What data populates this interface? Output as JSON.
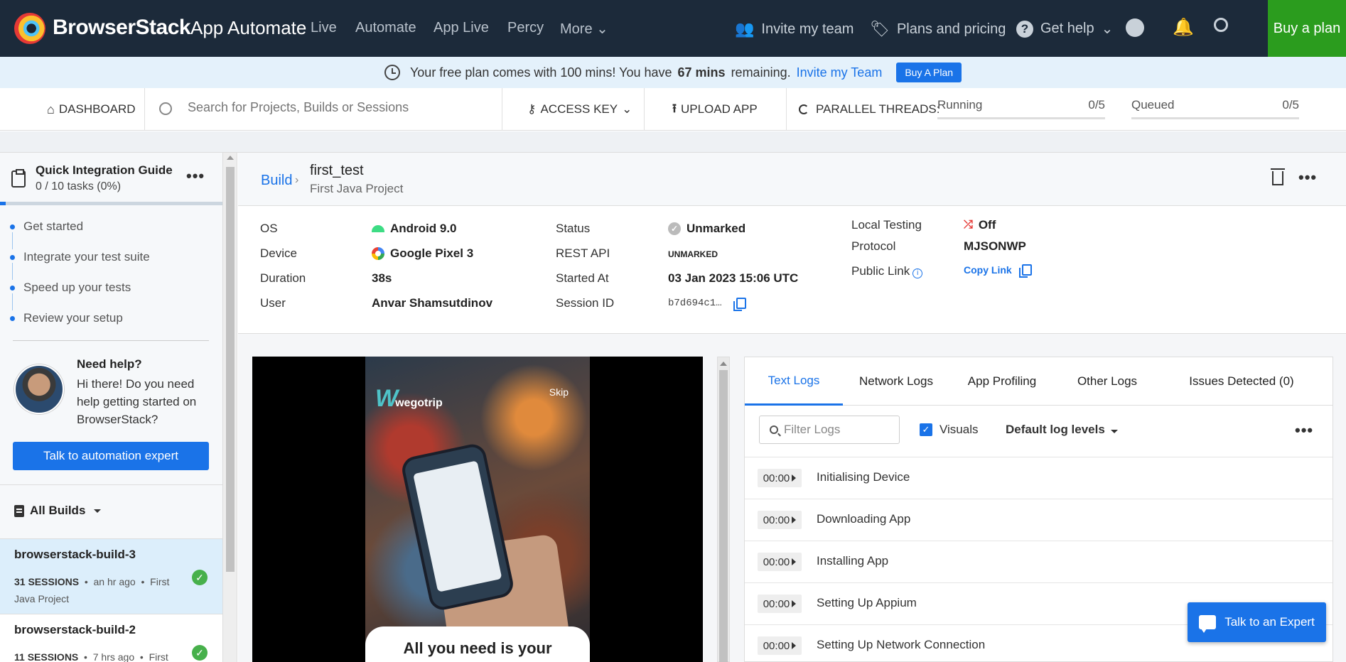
{
  "nav": {
    "brand": "BrowserStack",
    "product": "App Automate",
    "links": [
      "Live",
      "Automate",
      "App Live",
      "Percy",
      "More"
    ],
    "invite": "Invite my team",
    "plans": "Plans and pricing",
    "help": "Get help",
    "buy": "Buy a plan"
  },
  "banner": {
    "text_before": "Your free plan comes with 100 mins! You have",
    "remaining": "67 mins",
    "text_after": "remaining.",
    "invite_link": "Invite my Team",
    "button": "Buy A Plan"
  },
  "toolbar": {
    "dashboard": "DASHBOARD",
    "search_placeholder": "Search for Projects, Builds or Sessions",
    "access_key": "ACCESS KEY",
    "upload": "UPLOAD APP",
    "parallel": "PARALLEL THREADS:",
    "running_label": "Running",
    "running_value": "0/5",
    "queued_label": "Queued",
    "queued_value": "0/5"
  },
  "sidebar": {
    "guide_title": "Quick Integration Guide",
    "guide_progress": "0 / 10 tasks (0%)",
    "steps": [
      "Get started",
      "Integrate your test suite",
      "Speed up your tests",
      "Review your setup"
    ],
    "help_title": "Need help?",
    "help_text": "Hi there! Do you need help getting started on BrowserStack?",
    "talk_button": "Talk to automation expert",
    "all_builds": "All Builds",
    "builds": [
      {
        "name": "browserstack-build-3",
        "sessions": "31 SESSIONS",
        "time": "an hr ago",
        "project": "First Java Project"
      },
      {
        "name": "browserstack-build-2",
        "sessions": "11 SESSIONS",
        "time": "7 hrs ago",
        "project": "First"
      }
    ]
  },
  "session": {
    "crumb": "Build",
    "title": "first_test",
    "subtitle": "First Java Project",
    "os_label": "OS",
    "os": "Android 9.0",
    "device_label": "Device",
    "device": "Google Pixel 3",
    "duration_label": "Duration",
    "duration": "38s",
    "user_label": "User",
    "user": "Anvar Shamsutdinov",
    "status_label": "Status",
    "status": "Unmarked",
    "rest_label": "REST API",
    "rest": "UNMARKED",
    "started_label": "Started At",
    "started": "03 Jan 2023 15:06 UTC",
    "session_label": "Session ID",
    "session_id": "b7d694c1…",
    "local_label": "Local Testing",
    "local": "Off",
    "protocol_label": "Protocol",
    "protocol": "MJSONWP",
    "public_label": "Public Link",
    "public": "Copy Link"
  },
  "video": {
    "brand": "wegotrip",
    "skip": "Skip",
    "caption": "All you need is your"
  },
  "logs": {
    "tabs": [
      "Text Logs",
      "Network Logs",
      "App Profiling",
      "Other Logs",
      "Issues Detected (0)"
    ],
    "filter_placeholder": "Filter Logs",
    "visuals": "Visuals",
    "levels": "Default log levels",
    "rows": [
      {
        "time": "00:00",
        "text": "Initialising Device"
      },
      {
        "time": "00:00",
        "text": "Downloading App"
      },
      {
        "time": "00:00",
        "text": "Installing App"
      },
      {
        "time": "00:00",
        "text": "Setting Up Appium"
      },
      {
        "time": "00:00",
        "text": "Setting Up Network Connection"
      }
    ]
  },
  "expert_button": "Talk to an Expert"
}
